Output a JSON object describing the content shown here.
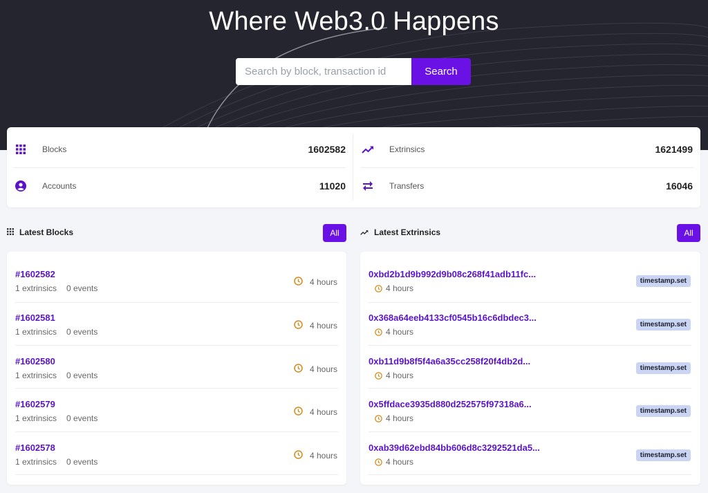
{
  "hero": {
    "title": "Where Web3.0 Happens",
    "search_placeholder": "Search by block, transaction id",
    "search_button": "Search"
  },
  "stats": {
    "blocks_label": "Blocks",
    "blocks_value": "1602582",
    "extrinsics_label": "Extrinsics",
    "extrinsics_value": "1621499",
    "accounts_label": "Accounts",
    "accounts_value": "11020",
    "transfers_label": "Transfers",
    "transfers_value": "16046"
  },
  "latest_blocks": {
    "title": "Latest Blocks",
    "all_label": "All",
    "rows": [
      {
        "id": "#1602582",
        "extrinsics": "1 extrinsics",
        "events": "0 events",
        "ago": "4 hours"
      },
      {
        "id": "#1602581",
        "extrinsics": "1 extrinsics",
        "events": "0 events",
        "ago": "4 hours"
      },
      {
        "id": "#1602580",
        "extrinsics": "1 extrinsics",
        "events": "0 events",
        "ago": "4 hours"
      },
      {
        "id": "#1602579",
        "extrinsics": "1 extrinsics",
        "events": "0 events",
        "ago": "4 hours"
      },
      {
        "id": "#1602578",
        "extrinsics": "1 extrinsics",
        "events": "0 events",
        "ago": "4 hours"
      }
    ]
  },
  "latest_extrinsics": {
    "title": "Latest Extrinsics",
    "all_label": "All",
    "rows": [
      {
        "hash": "0xbd2b1d9b992d9b08c268f41adb11fc...",
        "ago": "4 hours",
        "method": "timestamp.set"
      },
      {
        "hash": "0x368a64eeb4133cf0545b16c6dbdec3...",
        "ago": "4 hours",
        "method": "timestamp.set"
      },
      {
        "hash": "0xb11d9b8f5f4a6a35cc258f20f4db2d...",
        "ago": "4 hours",
        "method": "timestamp.set"
      },
      {
        "hash": "0x5ffdace3935d880d252575f97318a6...",
        "ago": "4 hours",
        "method": "timestamp.set"
      },
      {
        "hash": "0xab39d62ebd84bb606d8c3292521da5...",
        "ago": "4 hours",
        "method": "timestamp.set"
      }
    ]
  },
  "colors": {
    "accent": "#6a11e6",
    "link": "#5b13c8",
    "hero_bg": "#24252f",
    "clock": "#d48a1a",
    "badge_bg": "#c9d5f2"
  }
}
